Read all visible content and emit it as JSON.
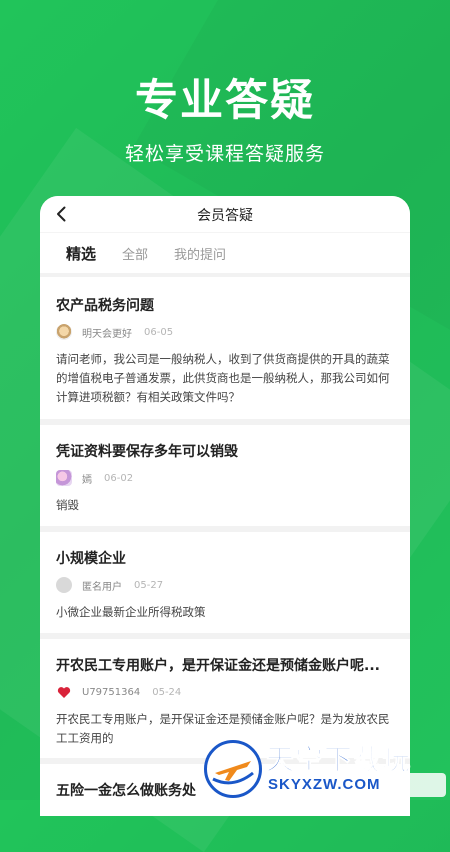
{
  "hero": {
    "title": "专业答疑",
    "subtitle": "轻松享受课程答疑服务"
  },
  "navbar": {
    "back_icon": "chevron-left-icon",
    "title": "会员答疑"
  },
  "tabs": [
    {
      "label": "精选",
      "active": true
    },
    {
      "label": "全部",
      "active": false
    },
    {
      "label": "我的提问",
      "active": false
    }
  ],
  "questions": [
    {
      "title": "农产品税务问题",
      "author": "明天会更好",
      "date": "06-05",
      "body": "请问老师，我公司是一般纳税人，收到了供货商提供的开具的蔬菜的增值税电子普通发票，此供货商也是一般纳税人，那我公司如何计算进项税额？有相关政策文件吗？"
    },
    {
      "title": "凭证资料要保存多年可以销毁",
      "author": "嫣",
      "date": "06-02",
      "body": "销毁"
    },
    {
      "title": "小规模企业",
      "author": "匿名用户",
      "date": "05-27",
      "body": "小微企业最新企业所得税政策"
    },
    {
      "title": "开农民工专用账户，是开保证金还是预储金账户呢...",
      "author": "U79751364",
      "date": "05-24",
      "body": "开农民工专用账户，是开保证金还是预储金账户呢？是为发放农民工工资用的"
    },
    {
      "title": "五险一金怎么做账务处",
      "author": "",
      "date": "",
      "body": ""
    }
  ],
  "watermark": {
    "big": "天空下载玩",
    "small": "SKYXZW.COM"
  },
  "colors": {
    "brand_green": "#1fb957",
    "watermark_blue": "#1a57c8"
  }
}
